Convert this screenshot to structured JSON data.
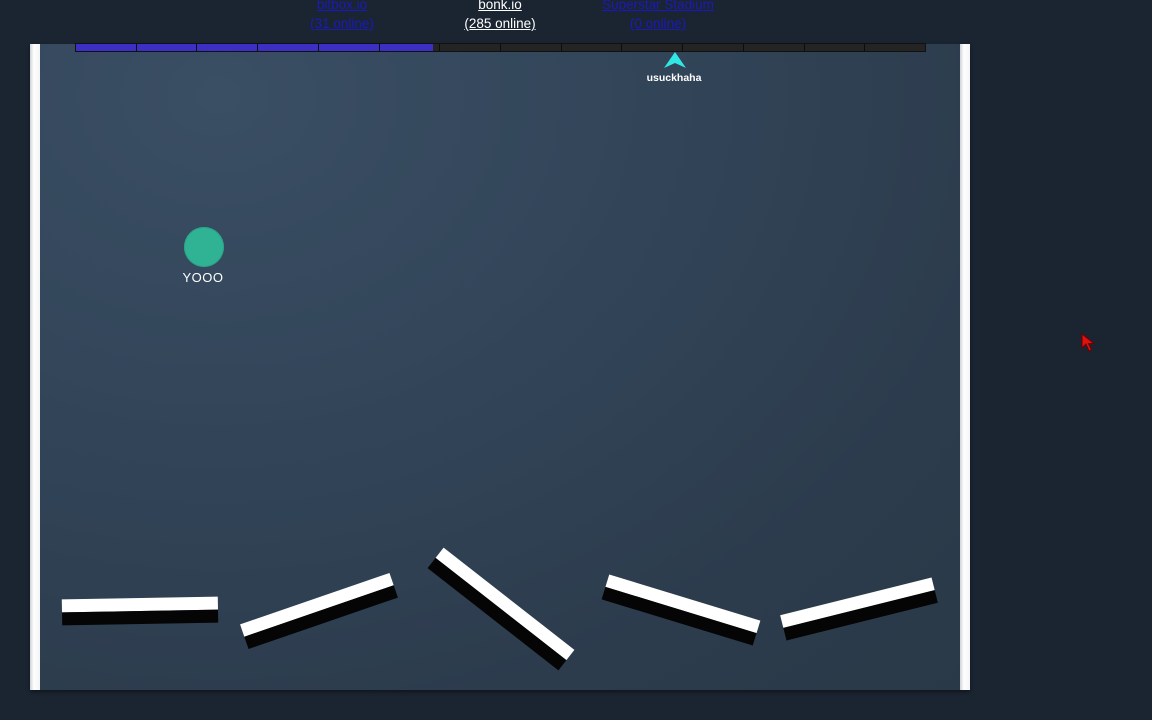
{
  "header": {
    "left_site": {
      "name": "bitbox.io",
      "online": "(31 online)"
    },
    "current_site": {
      "name": "bonk.io",
      "online": "(285 online)"
    },
    "right_site": {
      "name": "Superstar Stadium",
      "online": "(0 online)"
    }
  },
  "xp_bar": {
    "segments": 14,
    "filled_fraction": 0.42
  },
  "players": {
    "ball_player": {
      "name": "YOOO",
      "color": "#2fb394"
    },
    "arrow_player": {
      "name": "usuckhaha",
      "color": "#33e6e6"
    }
  },
  "colors": {
    "background": "#1b2532",
    "arena": "#33465a",
    "wall": "#ffffff",
    "xp_fill": "#3b2fc4"
  },
  "icons": {
    "arrow": "arrow-player-icon",
    "cursor": "red-cursor-icon"
  }
}
